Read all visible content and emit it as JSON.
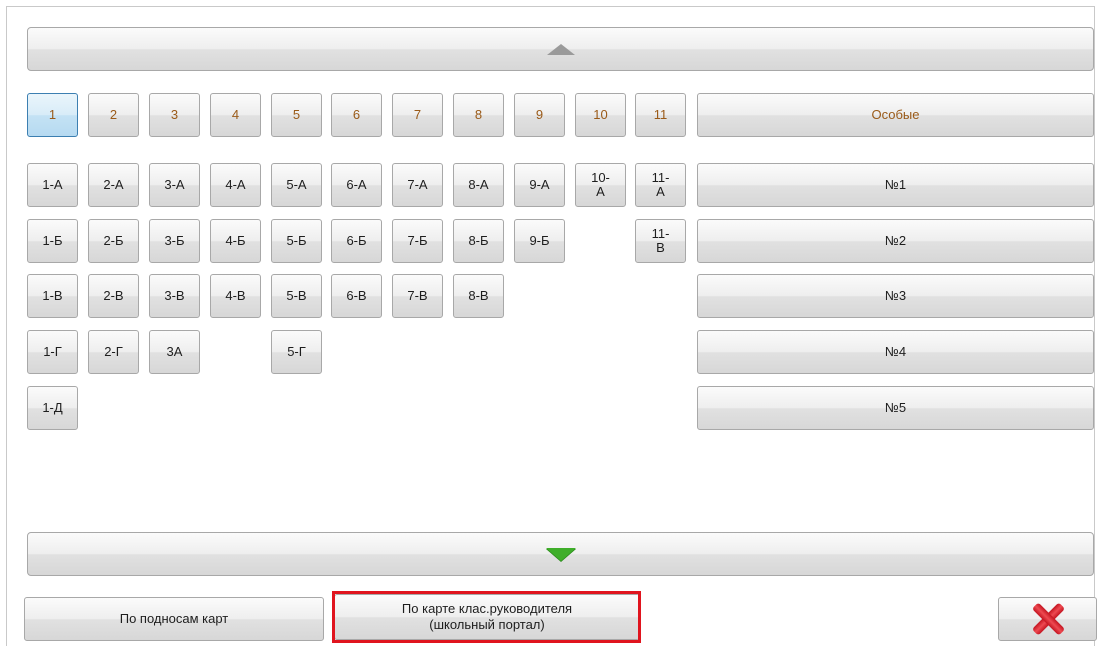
{
  "scroll": {
    "up_icon": "arrow-up-icon",
    "down_icon": "arrow-down-icon"
  },
  "grades": [
    "1",
    "2",
    "3",
    "4",
    "5",
    "6",
    "7",
    "8",
    "9",
    "10",
    "11"
  ],
  "special_label": "Особые",
  "classes": {
    "row1": [
      "1-А",
      "2-А",
      "3-А",
      "4-А",
      "5-А",
      "6-А",
      "7-А",
      "8-А",
      "9-А",
      "10-\nА",
      "11-\nА"
    ],
    "row2": [
      "1-Б",
      "2-Б",
      "3-Б",
      "4-Б",
      "5-Б",
      "6-Б",
      "7-Б",
      "8-Б",
      "9-Б",
      "11-\nВ"
    ],
    "row3": [
      "1-В",
      "2-В",
      "3-В",
      "4-В",
      "5-В",
      "6-В",
      "7-В",
      "8-В"
    ],
    "row4": [
      "1-Г",
      "2-Г",
      "3А",
      "5-Г"
    ],
    "row5": [
      "1-Д"
    ]
  },
  "specials": [
    "№1",
    "№2",
    "№3",
    "№4",
    "№5"
  ],
  "footer": {
    "trays_label": "По подносам карт",
    "teacher_card_label": "По карте клас.руководителя\n(школьный портал)",
    "close_icon": "close-icon",
    "highlight_color": "#e0141e"
  }
}
